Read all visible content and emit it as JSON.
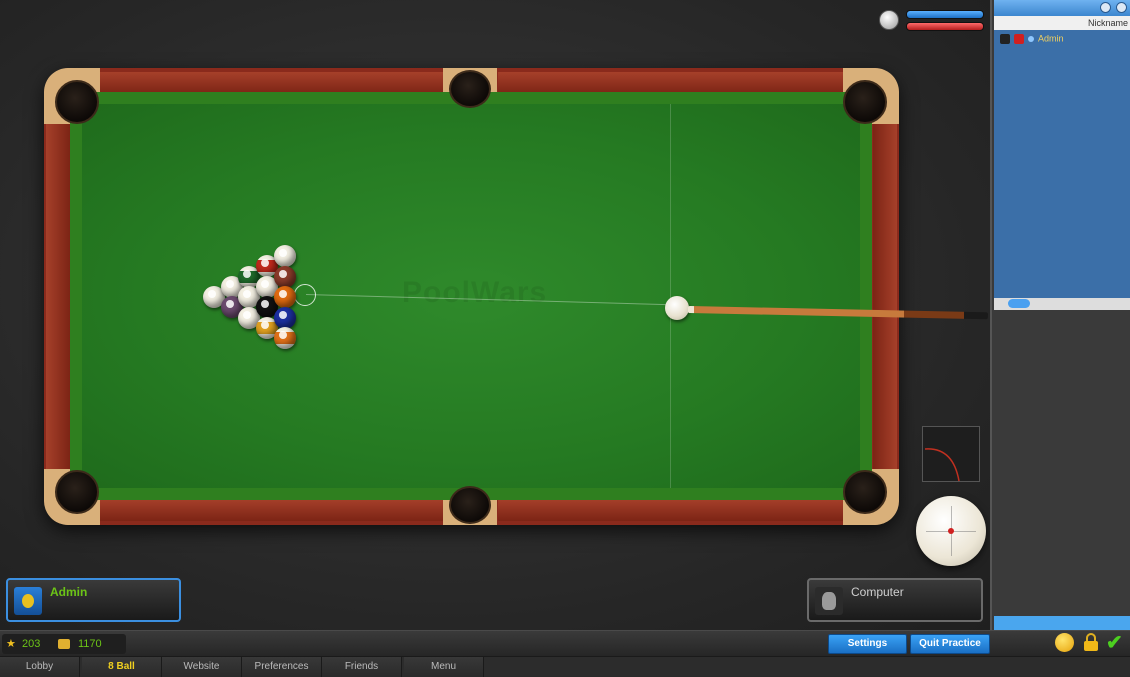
{
  "table": {
    "watermark": "PoolWars"
  },
  "balls": [
    {
      "kind": "solid",
      "color": "#f3efe2"
    },
    {
      "kind": "solid",
      "color": "#f3efe2"
    },
    {
      "kind": "solid",
      "color": "#6b4a6e"
    },
    {
      "kind": "stripe",
      "color": "#1f6a2a"
    },
    {
      "kind": "solid",
      "color": "#f3efe2"
    },
    {
      "kind": "solid",
      "color": "#f3efe2"
    },
    {
      "kind": "stripe",
      "color": "#c0281c"
    },
    {
      "kind": "solid",
      "color": "#f3efe2"
    },
    {
      "kind": "solid",
      "color": "#111111"
    },
    {
      "kind": "stripe",
      "color": "#e0a020"
    },
    {
      "kind": "solid",
      "color": "#f3efe2"
    },
    {
      "kind": "solid",
      "color": "#8a3a2a"
    },
    {
      "kind": "solid",
      "color": "#e06a10"
    },
    {
      "kind": "solid",
      "color": "#1c2fa0"
    },
    {
      "kind": "stripe",
      "color": "#e07018"
    }
  ],
  "players": {
    "left": {
      "name": "Admin"
    },
    "right": {
      "name": "Computer"
    }
  },
  "sidebar": {
    "column_header": "Nickname",
    "rows": [
      {
        "name": "Admin"
      }
    ]
  },
  "stats": {
    "stars": "203",
    "coins": "1170"
  },
  "buttons": {
    "settings": "Settings",
    "quit": "Quit Practice"
  },
  "tabs": [
    "Lobby",
    "8 Ball",
    "Website",
    "Preferences",
    "Friends",
    "Menu"
  ],
  "active_tab": "8 Ball",
  "colors": {
    "felt": "#257a22",
    "rail": "#8a2a1c",
    "accent_blue": "#3aa2f5",
    "name_green": "#6cc417"
  }
}
